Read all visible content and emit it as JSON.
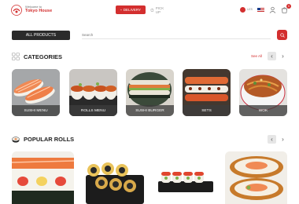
{
  "header": {
    "welcome": "Welcome to",
    "brand_name": "Tokyo House",
    "delivery_label": "DELIVERY",
    "pickup_label": "PICK UP",
    "currency_label": "UZS",
    "cart_count": "0"
  },
  "search": {
    "all_products_label": "ALL PRODUCTS",
    "placeholder": "Search"
  },
  "categories": {
    "title": "CATEGORIES",
    "see_all": "See All",
    "items": [
      {
        "label": "SUSHI MENU"
      },
      {
        "label": "ROLLS MENU"
      },
      {
        "label": "SUSHI BURGER"
      },
      {
        "label": "SETS"
      },
      {
        "label": "WOK"
      }
    ]
  },
  "popular": {
    "title": "POPULAR ROLLS"
  },
  "colors": {
    "accent": "#d32f2f",
    "dark_button": "#2b2b2b"
  },
  "icons": [
    "logo-icon",
    "delivery-icon",
    "pickup-icon",
    "flag-icon",
    "user-icon",
    "cart-icon",
    "search-icon",
    "grid-icon",
    "roll-icon",
    "chevron-left-icon",
    "chevron-right-icon"
  ]
}
